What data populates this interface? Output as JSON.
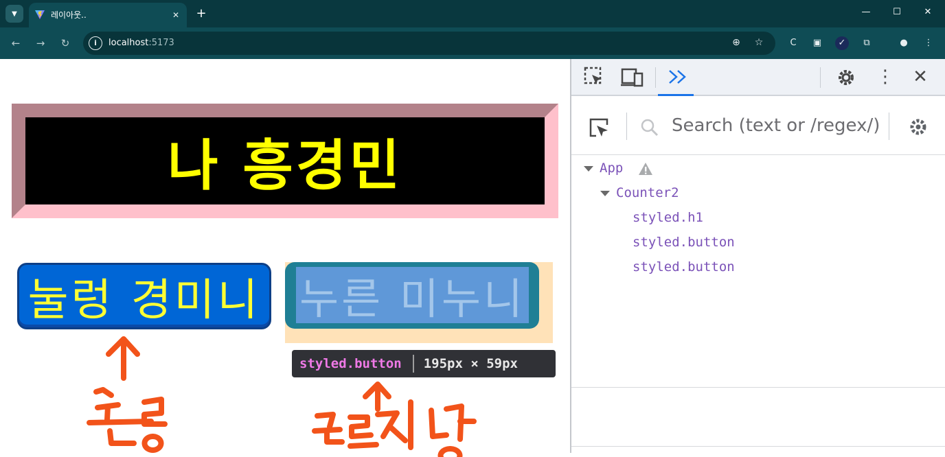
{
  "browser": {
    "tab_title": "레이아웃..",
    "url_host": "localhost",
    "url_port": ":5173"
  },
  "page": {
    "title_text": "나 흥경민",
    "button_pressed_label": "눌렁 경미니",
    "button_normal_label": "누른 미누니",
    "inspect_tooltip": {
      "name": "styled.button",
      "size": "195px × 59px"
    },
    "annotation_colors": {
      "scribble": "#f2531a"
    }
  },
  "devtools": {
    "search_placeholder": "Search (text or /regex/)",
    "tree": [
      {
        "label": "App",
        "level": 0,
        "expanded": true,
        "warning": true
      },
      {
        "label": "Counter2",
        "level": 1,
        "expanded": true,
        "warning": false
      },
      {
        "label": "styled.h1",
        "level": 2,
        "expanded": false,
        "warning": false
      },
      {
        "label": "styled.button",
        "level": 2,
        "expanded": false,
        "warning": false
      },
      {
        "label": "styled.button",
        "level": 2,
        "expanded": false,
        "warning": false
      }
    ]
  },
  "colors": {
    "chrome_dark": "#09383f",
    "chrome_toolbar": "#0f4c55",
    "title_bg": "#000000",
    "title_text": "#ffff00",
    "pressed_button": "#0066d6",
    "normal_button": "#1f7f95",
    "devtools_tree_text": "#7b52b8",
    "devtools_accent": "#1a73e8"
  }
}
